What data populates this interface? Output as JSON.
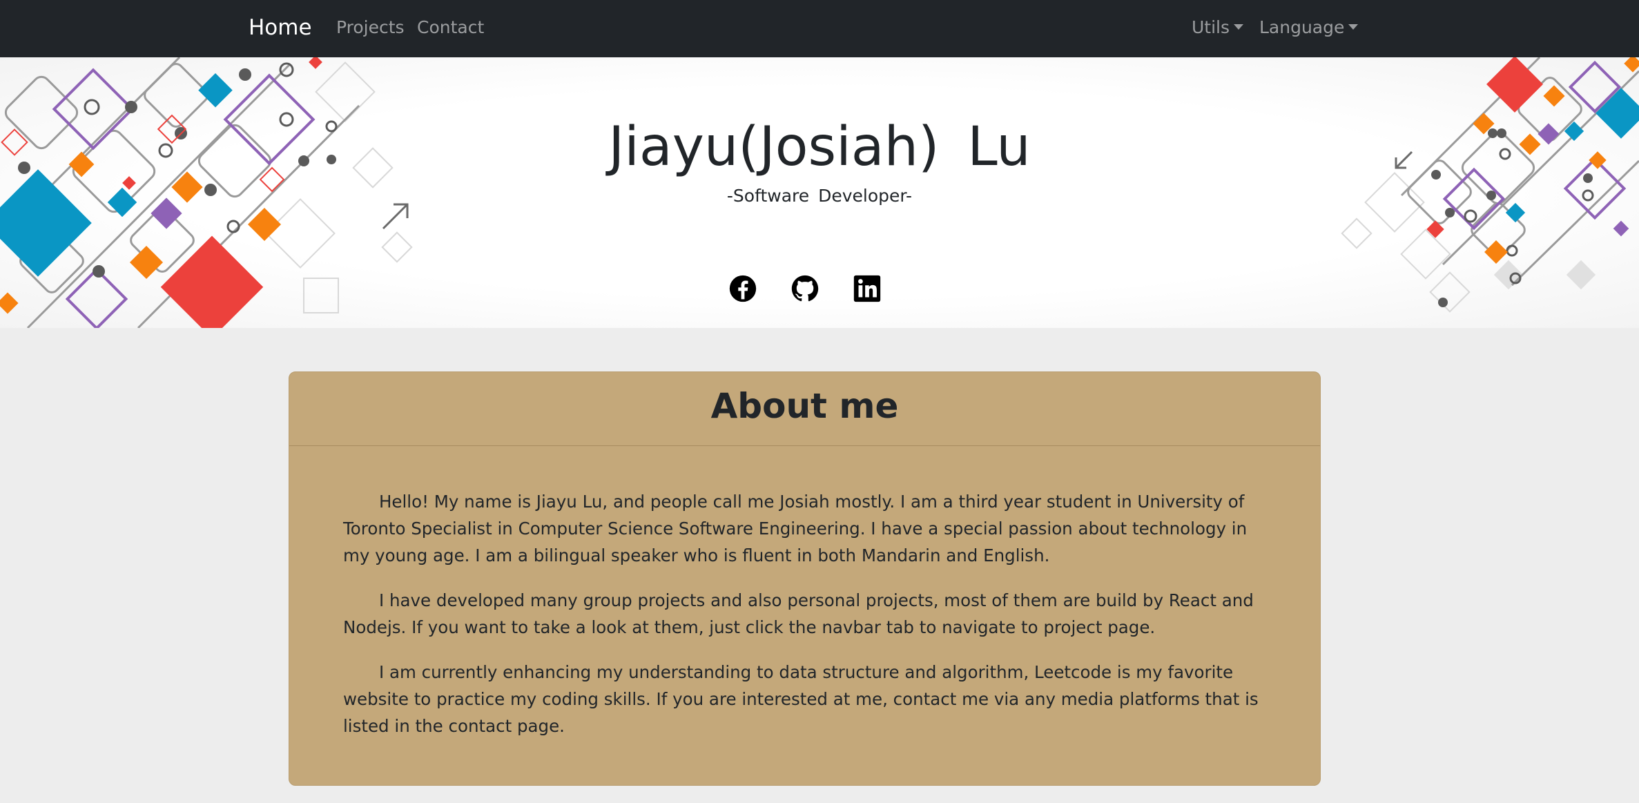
{
  "navbar": {
    "brand": "Home",
    "links": [
      "Projects",
      "Contact"
    ],
    "dropdowns": [
      "Utils",
      "Language"
    ]
  },
  "hero": {
    "name": "Jiayu(Josiah)  Lu",
    "subtitle": "-Software  Developer-",
    "social_icons": [
      "facebook-icon",
      "github-icon",
      "linkedin-icon"
    ]
  },
  "about": {
    "title": "About me",
    "paragraphs": [
      "Hello! My name is Jiayu Lu, and people call me Josiah mostly. I am a third year student in University of Toronto Specialist in Computer Science Software Engineering. I have a special passion about technology in my young age. I am a bilingual speaker who is fluent in both Mandarin and English.",
      "I have developed many group projects and also personal projects, most of them are build by React and Nodejs. If you want to take a look at them, just click the navbar tab to navigate to project page.",
      "I am currently enhancing my understanding to data structure and algorithm, Leetcode is my favorite website to practice my coding skills. If you are interested at me, contact me via any media platforms that is listed in the contact page."
    ]
  },
  "colors": {
    "navbar_bg": "#212529",
    "card_bg": "#c4a87a",
    "page_bg": "#ededed"
  }
}
